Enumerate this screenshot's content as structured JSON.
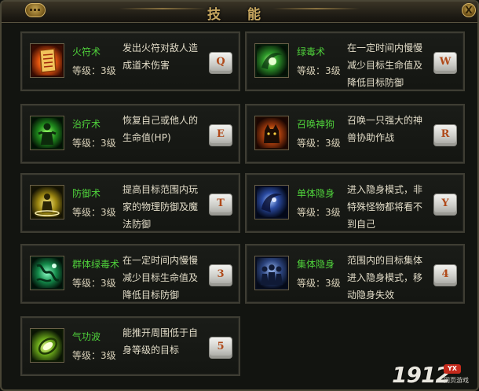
{
  "window": {
    "title": "技 能",
    "close_label": "X"
  },
  "skills": [
    {
      "name": "火符术",
      "level": "等级：3级",
      "desc": "发出火符对敌人造成道术伤害",
      "key": "Q",
      "icon": "fire-talisman-icon"
    },
    {
      "name": "绿毒术",
      "level": "等级：3级",
      "desc": "在一定时间内慢慢减少目标生命值及降低目标防御",
      "key": "W",
      "icon": "green-poison-icon"
    },
    {
      "name": "治疗术",
      "level": "等级：3级",
      "desc": "恢复自己或他人的生命值(HP)",
      "key": "E",
      "icon": "healing-icon"
    },
    {
      "name": "召唤神狗",
      "level": "等级：3级",
      "desc": "召唤一只强大的神兽协助作战",
      "key": "R",
      "icon": "summon-dog-icon"
    },
    {
      "name": "防御术",
      "level": "等级：3级",
      "desc": "提高目标范围内玩家的物理防御及魔法防御",
      "key": "T",
      "icon": "defense-icon"
    },
    {
      "name": "单体隐身",
      "level": "等级：3级",
      "desc": "进入隐身模式，非特殊怪物都将看不到自己",
      "key": "Y",
      "icon": "single-stealth-icon"
    },
    {
      "name": "群体绿毒术",
      "level": "等级：3级",
      "desc": "在一定时间内慢慢减少目标生命值及降低目标防御",
      "key": "3",
      "icon": "group-poison-icon"
    },
    {
      "name": "集体隐身",
      "level": "等级：3级",
      "desc": "范围内的目标集体进入隐身模式，移动隐身失效",
      "key": "4",
      "icon": "group-stealth-icon"
    },
    {
      "name": "气功波",
      "level": "等级：3级",
      "desc": "能推开周围低于自身等级的目标",
      "key": "5",
      "icon": "qigong-wave-icon"
    }
  ],
  "watermark": {
    "text": "1912",
    "badge": "YX",
    "sub": "网页游戏"
  },
  "colors": {
    "skill_name": "#4fd13b",
    "title_gold": "#c9a860",
    "key_text": "#b04a1a"
  }
}
